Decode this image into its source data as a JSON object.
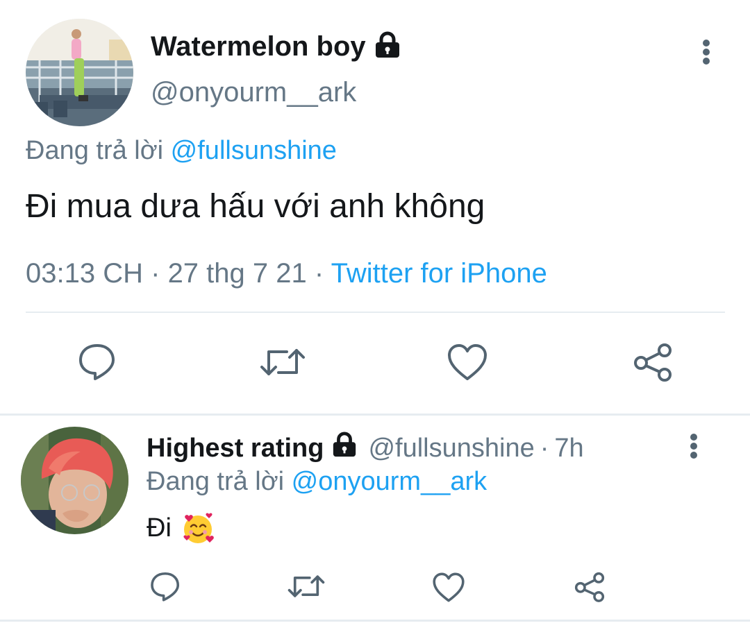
{
  "main_tweet": {
    "display_name": "Watermelon boy",
    "handle": "@onyourm__ark",
    "replying_prefix": "Đang trả lời",
    "replying_to": "@fullsunshine",
    "text": "Đi mua dưa hấu với anh không",
    "time": "03:13 CH",
    "separator1": "·",
    "date": "27 thg 7 21",
    "separator2": "·",
    "source": "Twitter for iPhone",
    "actions": [
      "reply-icon",
      "retweet-icon",
      "like-icon",
      "share-icon"
    ]
  },
  "reply_tweet": {
    "display_name": "Highest rating",
    "handle": "@fullsunshine",
    "separator": "·",
    "age": "7h",
    "replying_prefix": "Đang trả lời",
    "replying_to": "@onyourm__ark",
    "text": "Đi",
    "emoji": "🥰",
    "actions": [
      "reply-icon",
      "retweet-icon",
      "like-icon",
      "share-icon"
    ]
  },
  "colors": {
    "link": "#1da1f2",
    "muted": "#657786",
    "icon": "#536471",
    "divider": "#e6ecf0"
  }
}
